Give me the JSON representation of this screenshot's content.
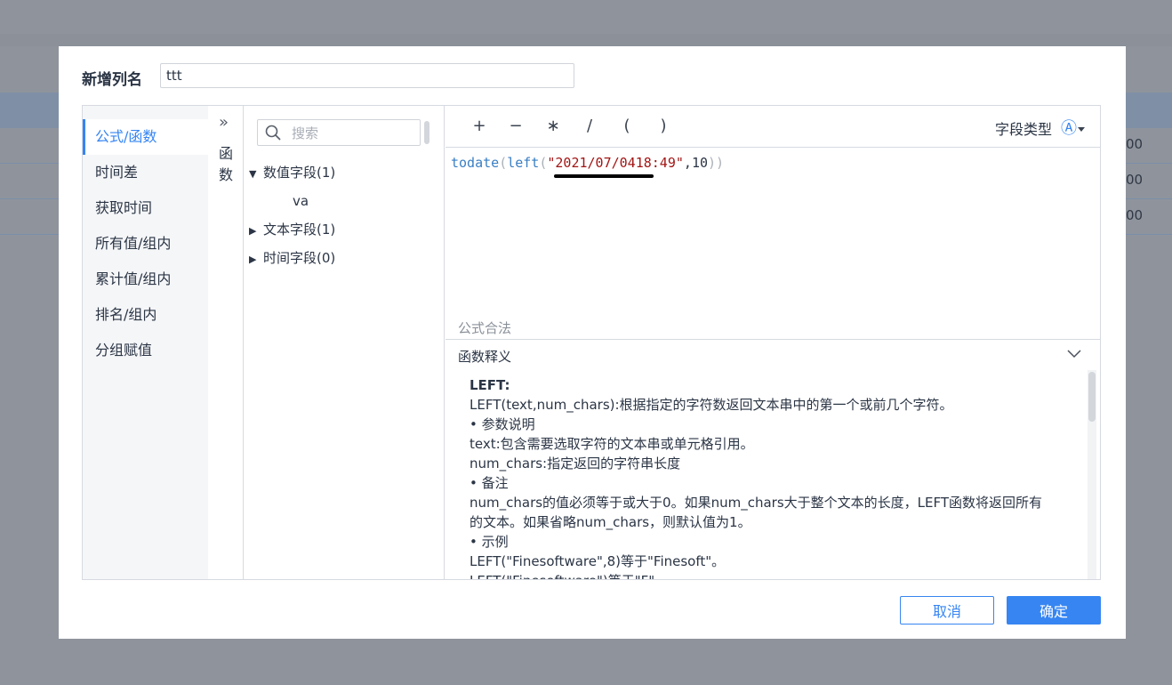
{
  "background": {
    "row_values": [
      "00",
      "00",
      "00"
    ]
  },
  "dialog": {
    "name_label": "新增列名",
    "name_value": "ttt"
  },
  "categories": [
    {
      "label": "公式/函数",
      "active": true
    },
    {
      "label": "时间差"
    },
    {
      "label": "获取时间"
    },
    {
      "label": "所有值/组内"
    },
    {
      "label": "累计值/组内"
    },
    {
      "label": "排名/组内"
    },
    {
      "label": "分组赋值"
    }
  ],
  "function_tab": {
    "chevron": "»",
    "label_1": "函",
    "label_2": "数"
  },
  "fields": {
    "search_placeholder": "搜索",
    "tree": [
      {
        "label": "数值字段(1)",
        "expanded": true,
        "children": [
          "va"
        ]
      },
      {
        "label": "文本字段(1)",
        "expanded": false
      },
      {
        "label": "时间字段(0)",
        "expanded": false
      }
    ]
  },
  "operators": [
    "+",
    "−",
    "∗",
    "/",
    "(",
    ")"
  ],
  "field_type": {
    "label": "字段类型",
    "icon_glyph": "Ⓐ"
  },
  "formula": {
    "fn_outer": "todate",
    "p1": "(",
    "fn_inner": "left",
    "p2": "(",
    "string_arg": "\"2021/07/0418:49\"",
    "comma": ",",
    "num_arg": "10",
    "p3": ")",
    "p4": ")",
    "status": "公式合法"
  },
  "help": {
    "title": "函数释义",
    "lines": [
      "LEFT:",
      "LEFT(text,num_chars):根据指定的字符数返回文本串中的第一个或前几个字符。",
      "• 参数说明",
      "text:包含需要选取字符的文本串或单元格引用。",
      "num_chars:指定返回的字符串长度",
      "• 备注",
      "num_chars的值必须等于或大于0。如果num_chars大于整个文本的长度，LEFT函数将返回所有",
      "的文本。如果省略num_chars，则默认值为1。",
      "• 示例",
      "LEFT(\"Finesoftware\",8)等于\"Finesoft\"。",
      "LEFT(\"Finesoftware\")等于\"F\""
    ]
  },
  "buttons": {
    "cancel": "取消",
    "ok": "确定"
  },
  "colors": {
    "accent": "#3685f2",
    "overlay": "#8f949c",
    "string_token": "#a31515",
    "function_token": "#3a7fc4"
  }
}
